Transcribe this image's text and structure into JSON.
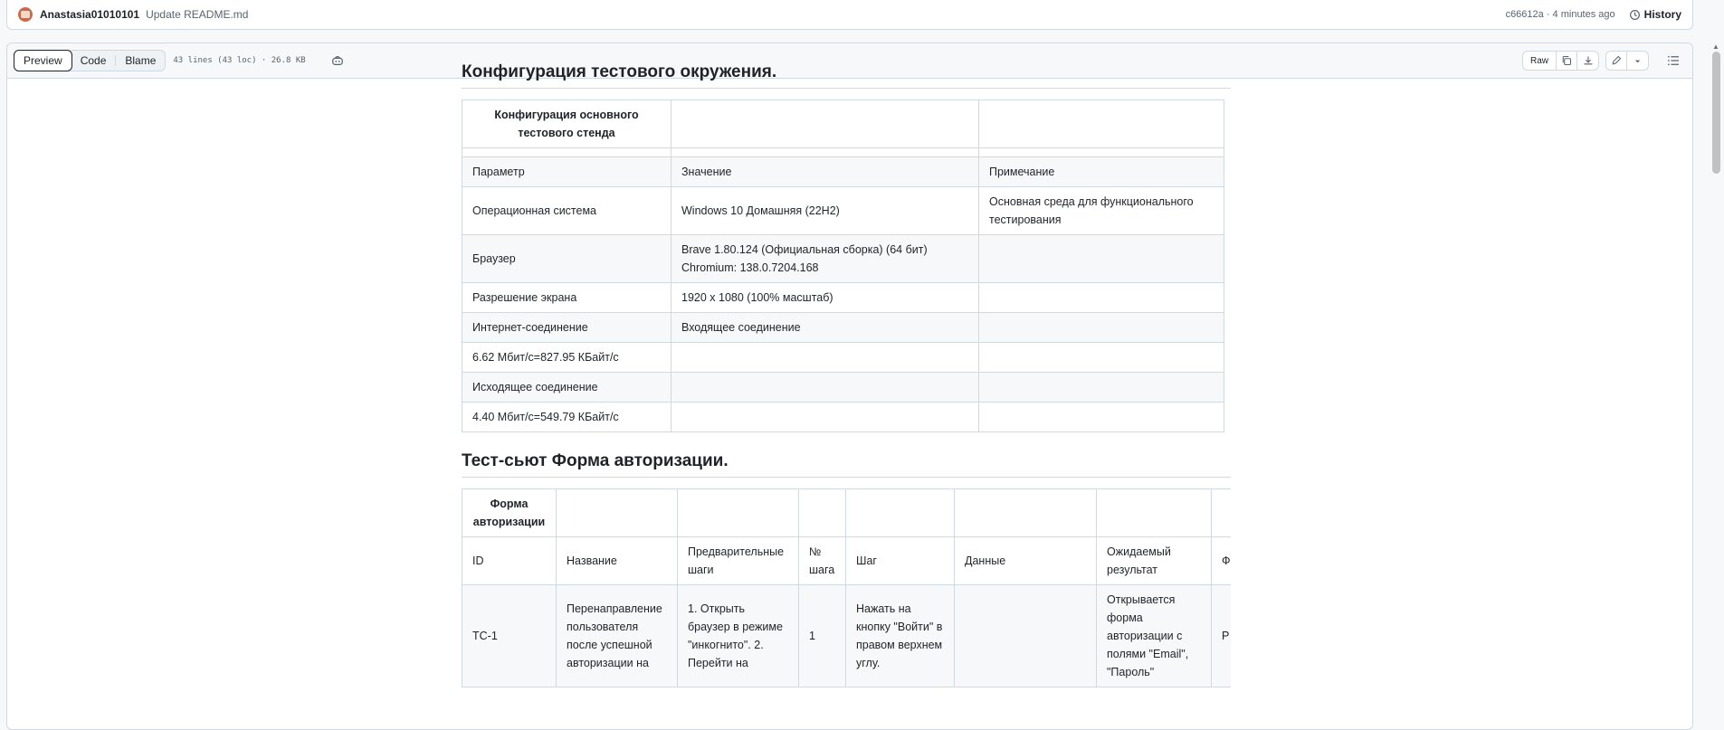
{
  "commit": {
    "author": "Anastasia01010101",
    "message": "Update README.md",
    "hash_time": "c66612a · 4 minutes ago",
    "history_label": "History"
  },
  "file_header": {
    "tabs": [
      "Preview",
      "Code",
      "Blame"
    ],
    "active_tab": "Preview",
    "info": "43 lines (43 loc) · 26.8 KB",
    "raw_label": "Raw"
  },
  "section1": {
    "heading": "Конфигурация тестового окружения.",
    "table_title": "Конфигурация основного тестового стенда",
    "headers": [
      "Параметр",
      "Значение",
      "Примечание"
    ],
    "rows": [
      [
        "Операционная система",
        "Windows 10 Домашняя (22H2)",
        "Основная среда для функционального тестирования"
      ],
      [
        "Браузер",
        "Brave 1.80.124 (Официальная сборка) (64 бит) Chromium: 138.0.7204.168",
        ""
      ],
      [
        "Разрешение экрана",
        "1920 x 1080 (100% масштаб)",
        ""
      ],
      [
        "Интернет-соединение",
        "Входящее соединение",
        ""
      ],
      [
        "6.62 Мбит/с=827.95 КБайт/с",
        "",
        ""
      ],
      [
        "Исходящее соединение",
        "",
        ""
      ],
      [
        "4.40 Мбит/с=549.79 КБайт/с",
        "",
        ""
      ]
    ]
  },
  "section2": {
    "heading": "Тест-сьют Форма авторизации.",
    "table_title": "Форма авторизации",
    "headers": [
      "ID",
      "Название",
      "Предварительные шаги",
      "№ шага",
      "Шаг",
      "Данные",
      "Ожидаемый результат",
      "Ф р"
    ],
    "row1": [
      "TC-1",
      "Перенаправление пользователя после успешной авторизации на",
      "1. Открыть браузер в режиме \"инкогнито\". 2. Перейти на",
      "1",
      "Нажать на кнопку \"Войти\" в правом верхнем углу.",
      "",
      "Открывается форма авторизации с полями \"Email\", \"Пароль\"",
      "Р"
    ]
  }
}
